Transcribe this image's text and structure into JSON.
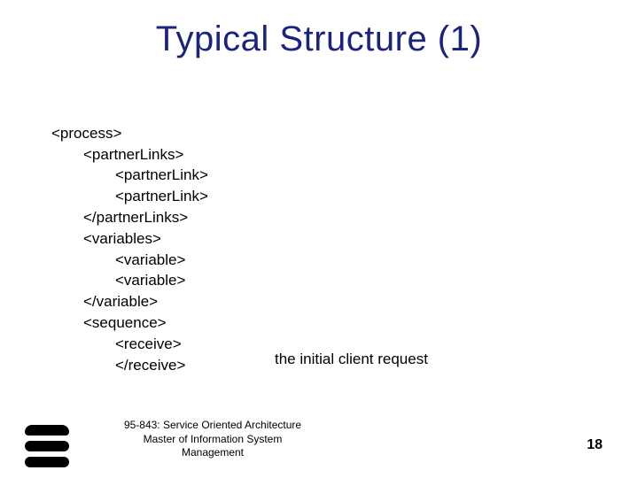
{
  "title": "Typical Structure (1)",
  "code": {
    "l0": "<process>",
    "l1": "<partnerLinks>",
    "l2": "<partnerLink>",
    "l3": "<partnerLink>",
    "l4": "</partnerLinks>",
    "l5": "<variables>",
    "l6": "<variable>",
    "l7": "<variable>",
    "l8": "</variable>",
    "l9": "<sequence>",
    "l10": "<receive>",
    "l11": "</receive>"
  },
  "annotation": "the initial client request",
  "footer": {
    "line1": "95-843: Service Oriented Architecture",
    "line2": "Master of Information System",
    "line3": "Management"
  },
  "page": "18"
}
